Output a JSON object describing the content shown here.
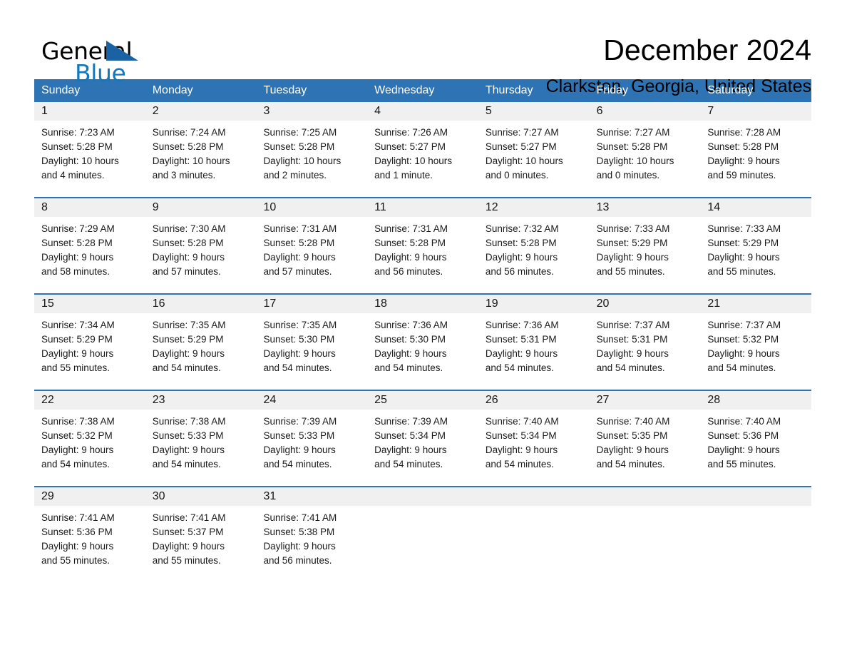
{
  "brand": {
    "name_part1": "General",
    "name_part2": "Blue",
    "logo_icon": "blue-triangle-icon",
    "colors": {
      "black": "#000000",
      "blue": "#1278be",
      "triangle": "#1b62a5"
    }
  },
  "header": {
    "month_title": "December 2024",
    "location": "Clarkston, Georgia, United States"
  },
  "calendar": {
    "accent_color": "#2e74b5",
    "daynum_band_color": "#f0f0f0",
    "weekdays": [
      "Sunday",
      "Monday",
      "Tuesday",
      "Wednesday",
      "Thursday",
      "Friday",
      "Saturday"
    ],
    "weeks": [
      [
        {
          "day": "1",
          "sunrise": "Sunrise: 7:23 AM",
          "sunset": "Sunset: 5:28 PM",
          "daylight_line1": "Daylight: 10 hours",
          "daylight_line2": "and 4 minutes."
        },
        {
          "day": "2",
          "sunrise": "Sunrise: 7:24 AM",
          "sunset": "Sunset: 5:28 PM",
          "daylight_line1": "Daylight: 10 hours",
          "daylight_line2": "and 3 minutes."
        },
        {
          "day": "3",
          "sunrise": "Sunrise: 7:25 AM",
          "sunset": "Sunset: 5:28 PM",
          "daylight_line1": "Daylight: 10 hours",
          "daylight_line2": "and 2 minutes."
        },
        {
          "day": "4",
          "sunrise": "Sunrise: 7:26 AM",
          "sunset": "Sunset: 5:27 PM",
          "daylight_line1": "Daylight: 10 hours",
          "daylight_line2": "and 1 minute."
        },
        {
          "day": "5",
          "sunrise": "Sunrise: 7:27 AM",
          "sunset": "Sunset: 5:27 PM",
          "daylight_line1": "Daylight: 10 hours",
          "daylight_line2": "and 0 minutes."
        },
        {
          "day": "6",
          "sunrise": "Sunrise: 7:27 AM",
          "sunset": "Sunset: 5:28 PM",
          "daylight_line1": "Daylight: 10 hours",
          "daylight_line2": "and 0 minutes."
        },
        {
          "day": "7",
          "sunrise": "Sunrise: 7:28 AM",
          "sunset": "Sunset: 5:28 PM",
          "daylight_line1": "Daylight: 9 hours",
          "daylight_line2": "and 59 minutes."
        }
      ],
      [
        {
          "day": "8",
          "sunrise": "Sunrise: 7:29 AM",
          "sunset": "Sunset: 5:28 PM",
          "daylight_line1": "Daylight: 9 hours",
          "daylight_line2": "and 58 minutes."
        },
        {
          "day": "9",
          "sunrise": "Sunrise: 7:30 AM",
          "sunset": "Sunset: 5:28 PM",
          "daylight_line1": "Daylight: 9 hours",
          "daylight_line2": "and 57 minutes."
        },
        {
          "day": "10",
          "sunrise": "Sunrise: 7:31 AM",
          "sunset": "Sunset: 5:28 PM",
          "daylight_line1": "Daylight: 9 hours",
          "daylight_line2": "and 57 minutes."
        },
        {
          "day": "11",
          "sunrise": "Sunrise: 7:31 AM",
          "sunset": "Sunset: 5:28 PM",
          "daylight_line1": "Daylight: 9 hours",
          "daylight_line2": "and 56 minutes."
        },
        {
          "day": "12",
          "sunrise": "Sunrise: 7:32 AM",
          "sunset": "Sunset: 5:28 PM",
          "daylight_line1": "Daylight: 9 hours",
          "daylight_line2": "and 56 minutes."
        },
        {
          "day": "13",
          "sunrise": "Sunrise: 7:33 AM",
          "sunset": "Sunset: 5:29 PM",
          "daylight_line1": "Daylight: 9 hours",
          "daylight_line2": "and 55 minutes."
        },
        {
          "day": "14",
          "sunrise": "Sunrise: 7:33 AM",
          "sunset": "Sunset: 5:29 PM",
          "daylight_line1": "Daylight: 9 hours",
          "daylight_line2": "and 55 minutes."
        }
      ],
      [
        {
          "day": "15",
          "sunrise": "Sunrise: 7:34 AM",
          "sunset": "Sunset: 5:29 PM",
          "daylight_line1": "Daylight: 9 hours",
          "daylight_line2": "and 55 minutes."
        },
        {
          "day": "16",
          "sunrise": "Sunrise: 7:35 AM",
          "sunset": "Sunset: 5:29 PM",
          "daylight_line1": "Daylight: 9 hours",
          "daylight_line2": "and 54 minutes."
        },
        {
          "day": "17",
          "sunrise": "Sunrise: 7:35 AM",
          "sunset": "Sunset: 5:30 PM",
          "daylight_line1": "Daylight: 9 hours",
          "daylight_line2": "and 54 minutes."
        },
        {
          "day": "18",
          "sunrise": "Sunrise: 7:36 AM",
          "sunset": "Sunset: 5:30 PM",
          "daylight_line1": "Daylight: 9 hours",
          "daylight_line2": "and 54 minutes."
        },
        {
          "day": "19",
          "sunrise": "Sunrise: 7:36 AM",
          "sunset": "Sunset: 5:31 PM",
          "daylight_line1": "Daylight: 9 hours",
          "daylight_line2": "and 54 minutes."
        },
        {
          "day": "20",
          "sunrise": "Sunrise: 7:37 AM",
          "sunset": "Sunset: 5:31 PM",
          "daylight_line1": "Daylight: 9 hours",
          "daylight_line2": "and 54 minutes."
        },
        {
          "day": "21",
          "sunrise": "Sunrise: 7:37 AM",
          "sunset": "Sunset: 5:32 PM",
          "daylight_line1": "Daylight: 9 hours",
          "daylight_line2": "and 54 minutes."
        }
      ],
      [
        {
          "day": "22",
          "sunrise": "Sunrise: 7:38 AM",
          "sunset": "Sunset: 5:32 PM",
          "daylight_line1": "Daylight: 9 hours",
          "daylight_line2": "and 54 minutes."
        },
        {
          "day": "23",
          "sunrise": "Sunrise: 7:38 AM",
          "sunset": "Sunset: 5:33 PM",
          "daylight_line1": "Daylight: 9 hours",
          "daylight_line2": "and 54 minutes."
        },
        {
          "day": "24",
          "sunrise": "Sunrise: 7:39 AM",
          "sunset": "Sunset: 5:33 PM",
          "daylight_line1": "Daylight: 9 hours",
          "daylight_line2": "and 54 minutes."
        },
        {
          "day": "25",
          "sunrise": "Sunrise: 7:39 AM",
          "sunset": "Sunset: 5:34 PM",
          "daylight_line1": "Daylight: 9 hours",
          "daylight_line2": "and 54 minutes."
        },
        {
          "day": "26",
          "sunrise": "Sunrise: 7:40 AM",
          "sunset": "Sunset: 5:34 PM",
          "daylight_line1": "Daylight: 9 hours",
          "daylight_line2": "and 54 minutes."
        },
        {
          "day": "27",
          "sunrise": "Sunrise: 7:40 AM",
          "sunset": "Sunset: 5:35 PM",
          "daylight_line1": "Daylight: 9 hours",
          "daylight_line2": "and 54 minutes."
        },
        {
          "day": "28",
          "sunrise": "Sunrise: 7:40 AM",
          "sunset": "Sunset: 5:36 PM",
          "daylight_line1": "Daylight: 9 hours",
          "daylight_line2": "and 55 minutes."
        }
      ],
      [
        {
          "day": "29",
          "sunrise": "Sunrise: 7:41 AM",
          "sunset": "Sunset: 5:36 PM",
          "daylight_line1": "Daylight: 9 hours",
          "daylight_line2": "and 55 minutes."
        },
        {
          "day": "30",
          "sunrise": "Sunrise: 7:41 AM",
          "sunset": "Sunset: 5:37 PM",
          "daylight_line1": "Daylight: 9 hours",
          "daylight_line2": "and 55 minutes."
        },
        {
          "day": "31",
          "sunrise": "Sunrise: 7:41 AM",
          "sunset": "Sunset: 5:38 PM",
          "daylight_line1": "Daylight: 9 hours",
          "daylight_line2": "and 56 minutes."
        },
        {
          "day": "",
          "sunrise": "",
          "sunset": "",
          "daylight_line1": "",
          "daylight_line2": ""
        },
        {
          "day": "",
          "sunrise": "",
          "sunset": "",
          "daylight_line1": "",
          "daylight_line2": ""
        },
        {
          "day": "",
          "sunrise": "",
          "sunset": "",
          "daylight_line1": "",
          "daylight_line2": ""
        },
        {
          "day": "",
          "sunrise": "",
          "sunset": "",
          "daylight_line1": "",
          "daylight_line2": ""
        }
      ]
    ]
  }
}
